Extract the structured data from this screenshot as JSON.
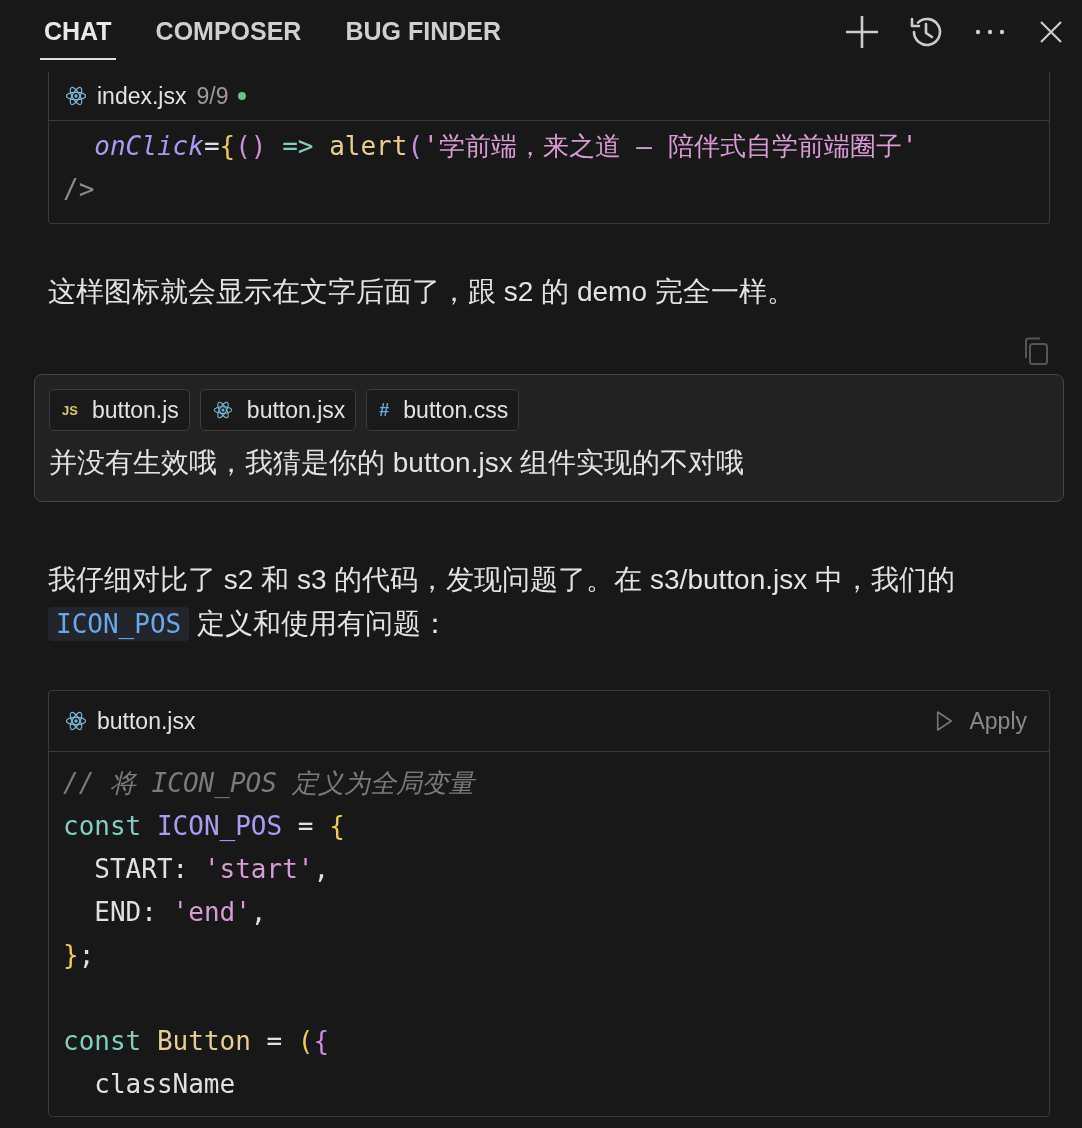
{
  "tabs": [
    {
      "label": "CHAT",
      "selected": true
    },
    {
      "label": "COMPOSER",
      "selected": false
    },
    {
      "label": "BUG FINDER",
      "selected": false
    }
  ],
  "code_block_1": {
    "file": "index.jsx",
    "kind": "react",
    "counter": "9/9",
    "modified": true,
    "lines": [
      {
        "indent": true,
        "tokens": [
          {
            "kind": "attr",
            "text": "onClick"
          },
          {
            "kind": "plain",
            "text": "="
          },
          {
            "kind": "brace",
            "text": "{"
          },
          {
            "kind": "paren",
            "text": "() "
          },
          {
            "kind": "keyword",
            "text": "=> "
          },
          {
            "kind": "func",
            "text": "alert"
          },
          {
            "kind": "paren",
            "text": "("
          },
          {
            "kind": "string",
            "text": "'学前端，来之道 — 陪伴式自学前端圈子'"
          }
        ]
      },
      {
        "indent": false,
        "tokens": [
          {
            "kind": "muted",
            "text": "/>"
          }
        ]
      }
    ]
  },
  "reply_1": "这样图标就会显示在文字后面了，跟 s2 的 demo 完全一样。",
  "user_message": {
    "attachments": [
      {
        "kind": "js",
        "badge": "JS",
        "name": "button.js"
      },
      {
        "kind": "react",
        "name": "button.jsx"
      },
      {
        "kind": "css",
        "badge": "#",
        "name": "button.css"
      }
    ],
    "text": "并没有生效哦，我猜是你的 button.jsx 组件实现的不对哦"
  },
  "reply_2": {
    "before": "我仔细对比了 s2 和 s3 的代码，发现问题了。在 s3/button.jsx 中，我们的",
    "code": "ICON_POS",
    "after": "定义和使用有问题："
  },
  "code_block_2": {
    "file": "button.jsx",
    "kind": "react",
    "action": "Apply",
    "lines": [
      {
        "indent": false,
        "tokens": [
          {
            "kind": "comment",
            "text": "// 将 ICON_POS 定义为全局变量"
          }
        ]
      },
      {
        "indent": false,
        "tokens": [
          {
            "kind": "keyword",
            "text": "const "
          },
          {
            "kind": "ident",
            "text": "ICON_POS "
          },
          {
            "kind": "plain",
            "text": "= "
          },
          {
            "kind": "brace",
            "text": "{"
          }
        ]
      },
      {
        "indent": true,
        "tokens": [
          {
            "kind": "plain",
            "text": "START: "
          },
          {
            "kind": "string",
            "text": "'start'"
          },
          {
            "kind": "plain",
            "text": ","
          }
        ]
      },
      {
        "indent": true,
        "tokens": [
          {
            "kind": "plain",
            "text": "END: "
          },
          {
            "kind": "string",
            "text": "'end'"
          },
          {
            "kind": "plain",
            "text": ","
          }
        ]
      },
      {
        "indent": false,
        "tokens": [
          {
            "kind": "brace",
            "text": "}"
          },
          {
            "kind": "plain",
            "text": ";"
          }
        ]
      },
      {
        "indent": false,
        "blank_before": true,
        "tokens": [
          {
            "kind": "keyword",
            "text": "const "
          },
          {
            "kind": "func",
            "text": "Button "
          },
          {
            "kind": "plain",
            "text": "= "
          },
          {
            "kind": "paren2",
            "text": "("
          },
          {
            "kind": "paren",
            "text": "{"
          }
        ]
      },
      {
        "indent": true,
        "tokens": [
          {
            "kind": "plain",
            "text": "className"
          }
        ]
      }
    ]
  }
}
